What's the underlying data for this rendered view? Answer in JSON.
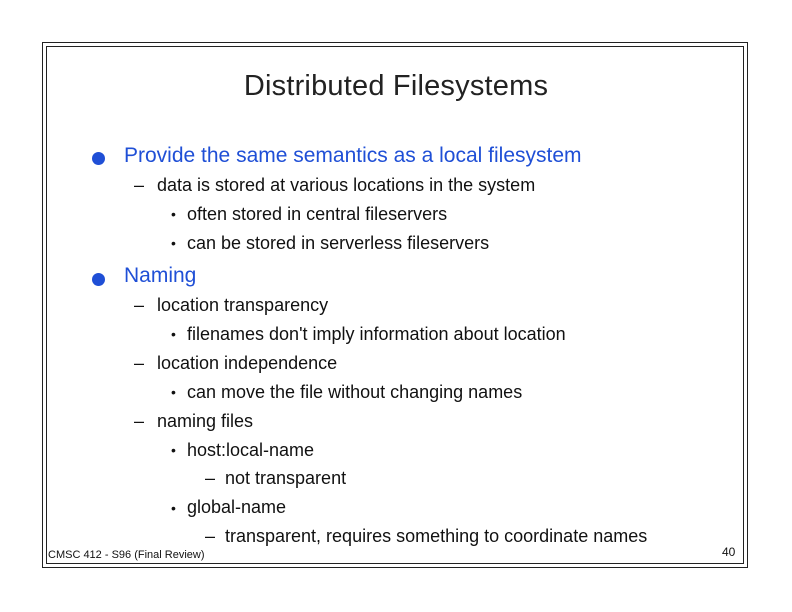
{
  "slide": {
    "title": "Distributed Filesystems",
    "bullets": [
      {
        "text": "Provide the same semantics as a local filesystem",
        "sub": [
          {
            "text": "data is stored at various locations in the system",
            "items": [
              {
                "text": "often stored in central fileservers"
              },
              {
                "text": "can be stored in serverless fileservers"
              }
            ]
          }
        ]
      },
      {
        "text": "Naming",
        "sub": [
          {
            "text": "location transparency",
            "items": [
              {
                "text": "filenames don't imply information about location"
              }
            ]
          },
          {
            "text": "location independence",
            "items": [
              {
                "text": "can move the file without changing names"
              }
            ]
          },
          {
            "text": "naming files",
            "items": [
              {
                "text": "host:local-name",
                "sub": [
                  "not transparent"
                ]
              },
              {
                "text": "global-name",
                "sub": [
                  "transparent, requires something to coordinate names"
                ]
              }
            ]
          }
        ]
      }
    ],
    "footer_left": "CMSC 412 - S96 (Final Review)",
    "page_number": "40"
  },
  "colors": {
    "accent": "#1f4fd6",
    "text": "#111111"
  }
}
